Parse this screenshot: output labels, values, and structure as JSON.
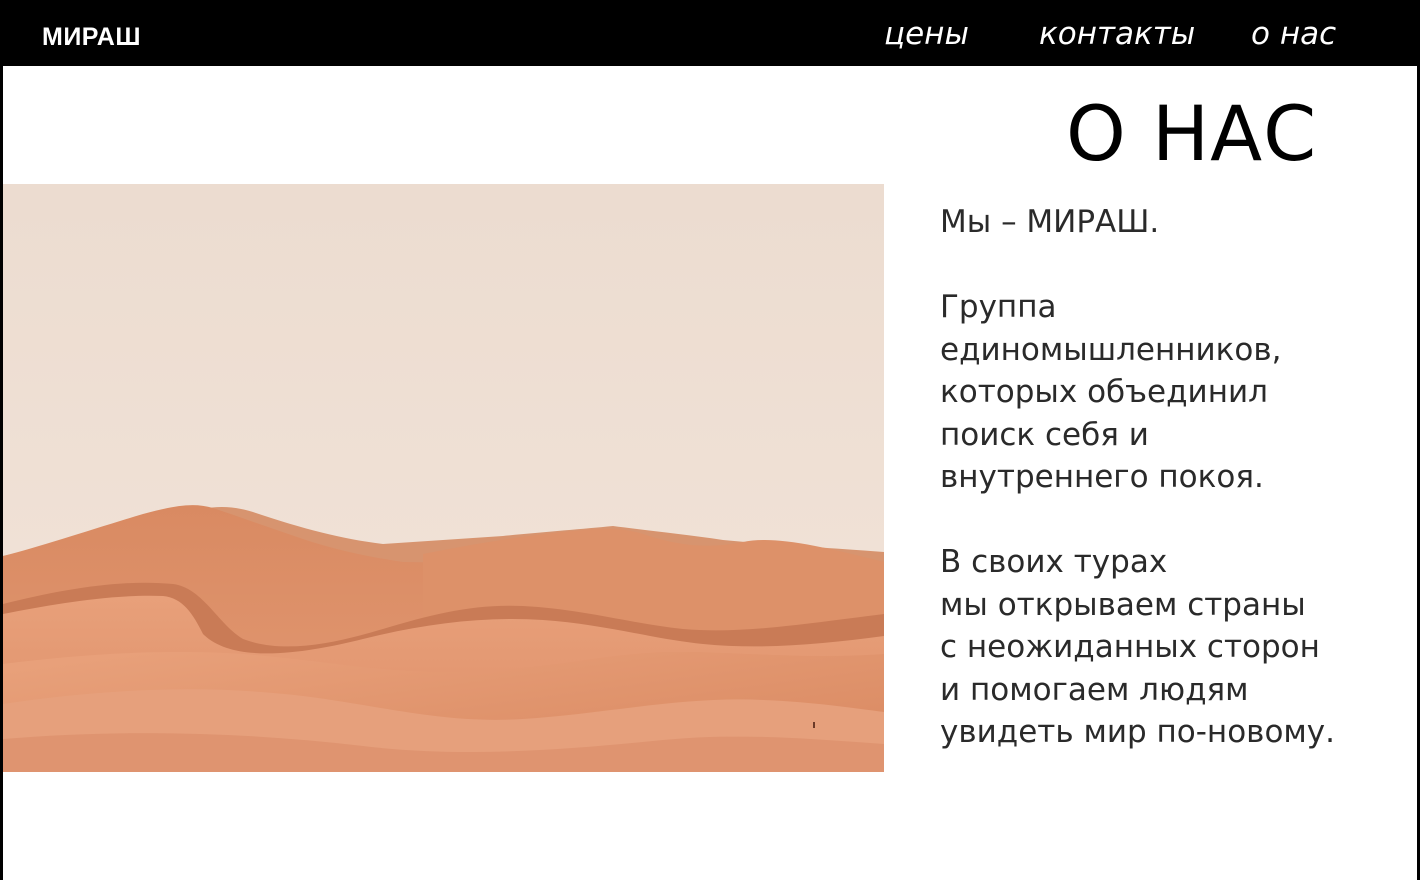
{
  "header": {
    "logo": "МИРАШ",
    "nav": [
      {
        "label": "цены"
      },
      {
        "label": "контакты"
      },
      {
        "label": "о нас"
      }
    ]
  },
  "main": {
    "title": "О НАС",
    "paragraphs": [
      {
        "lines": [
          "Мы – МИРАШ."
        ]
      },
      {
        "lines": [
          "Группа",
          "единомышленников,",
          "которых объединил",
          "поиск себя и",
          "внутреннего покоя."
        ]
      },
      {
        "lines": [
          "В своих турах",
          "мы открываем страны",
          "с неожиданных сторон",
          "и помогаем людям",
          "увидеть мир по-новому."
        ]
      }
    ]
  },
  "colors": {
    "header_bg": "#000000",
    "page_bg": "#ffffff",
    "sky": "#ecdcd0",
    "sand": "#e0906a"
  }
}
